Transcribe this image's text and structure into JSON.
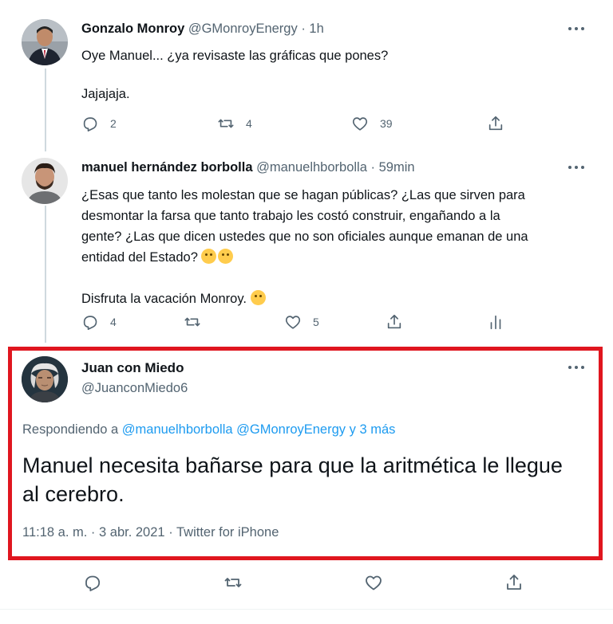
{
  "tweets": [
    {
      "name": "Gonzalo Monroy",
      "handle": "@GMonroyEnergy",
      "dot": "·",
      "time": "1h",
      "text": "Oye Manuel... ¿ya revisaste las gráficas que pones?\n\nJajajaja.",
      "replies": "2",
      "retweets": "4",
      "likes": "39"
    },
    {
      "name": "manuel hernández borbolla",
      "handle": "@manuelhborbolla",
      "dot": "·",
      "time": "59min",
      "text_line1": "¿Esas que tanto les molestan que se hagan públicas? ¿Las que sirven para",
      "text_line2": "desmontar la farsa que tanto trabajo les costó construir, engañando a la",
      "text_line3": "gente? ¿Las que dicen ustedes que no son oficiales aunque emanan de una",
      "text_line4": "entidad del Estado?",
      "text_line5": "Disfruta la vacación Monroy.",
      "replies": "4",
      "retweets": "",
      "likes": "5"
    }
  ],
  "main": {
    "name": "Juan con Miedo",
    "handle": "@JuanconMiedo6",
    "replying_prefix": "Respondiendo a",
    "replying_user1": "@manuelhborbolla",
    "replying_user2": "@GMonroyEnergy",
    "replying_more": "y 3 más",
    "text": "Manuel necesita bañarse para que la aritmética le llegue al cerebro.",
    "time": "11:18 a. m.",
    "sep1": "·",
    "date": "3 abr. 2021",
    "sep2": "·",
    "source": "Twitter for iPhone"
  },
  "colors": {
    "accent": "#1d9bf0",
    "highlight_border": "#e0161f",
    "secondary_text": "#536471"
  },
  "icons": [
    "reply-icon",
    "retweet-icon",
    "like-icon",
    "share-icon",
    "analytics-icon",
    "more-icon"
  ]
}
